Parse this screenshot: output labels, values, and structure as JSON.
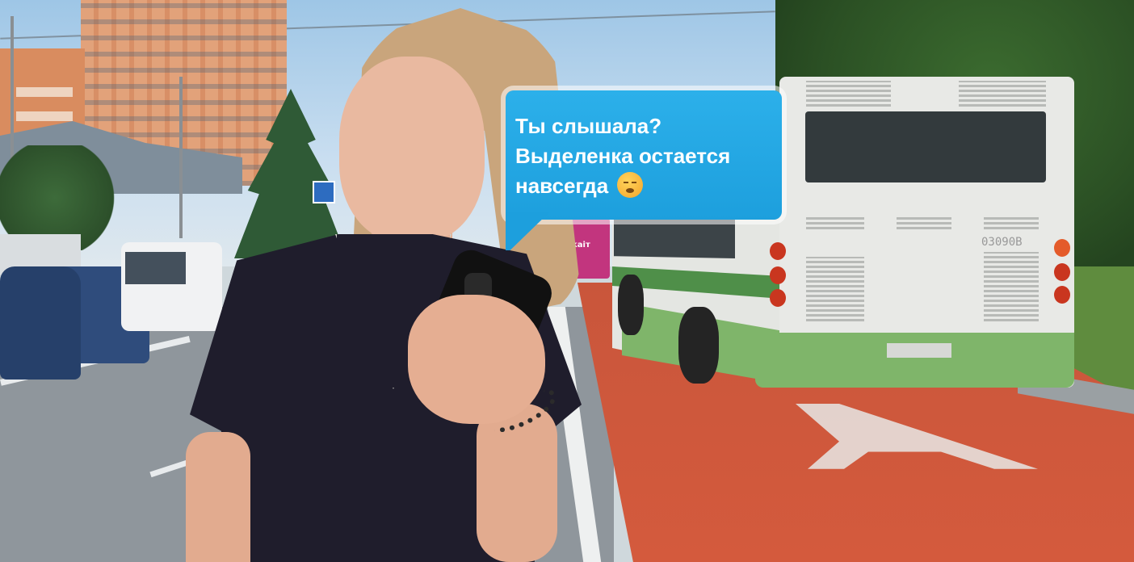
{
  "chat_bubble": {
    "lines": [
      "Ты слышала?",
      "Выделенка остается",
      "навсегда"
    ],
    "emoji": "weary-face-emoji",
    "color": "#1d9fdd"
  },
  "scene": {
    "lane_color": "#d45a3d",
    "bus_color": "#7fb56a",
    "pink_bus_label": "каіт",
    "bus_number": "03090В"
  }
}
